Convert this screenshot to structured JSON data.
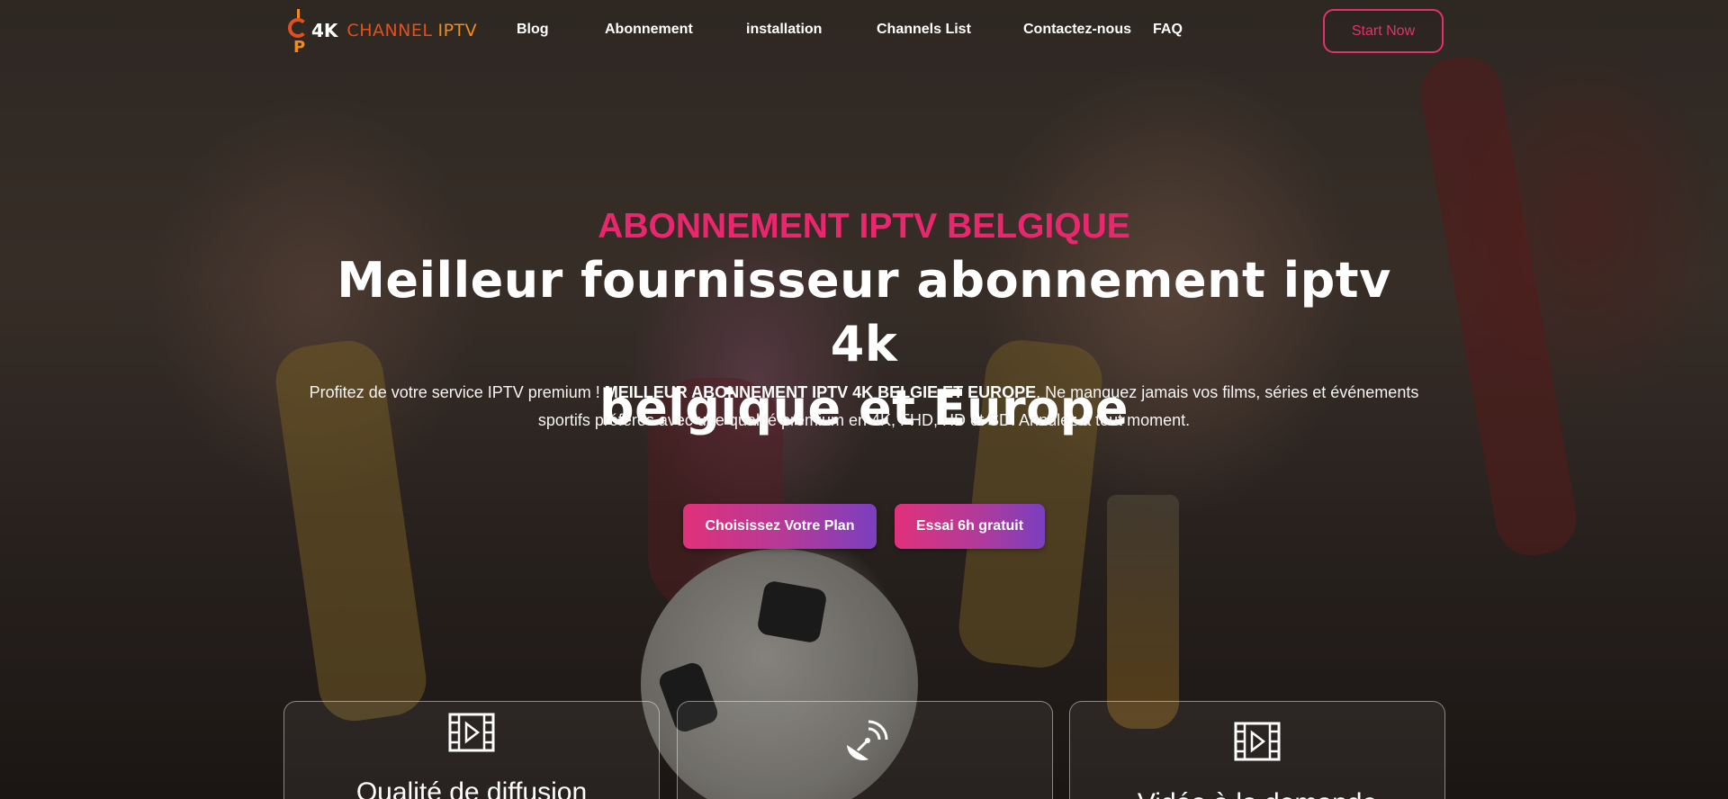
{
  "brand": {
    "logo_letter_p": "P",
    "prefix": "4K",
    "name_a": "CHANNEL",
    "name_b": "IPTV",
    "colors": {
      "orange_red": "#e2501d",
      "orange": "#f28c1a",
      "accent_pink": "#e9276f"
    }
  },
  "nav": {
    "items": [
      {
        "label": "Blog"
      },
      {
        "label": "Abonnement"
      },
      {
        "label": "installation"
      },
      {
        "label": "Channels List"
      },
      {
        "label": "Contactez-nous"
      },
      {
        "label": "FAQ"
      }
    ],
    "cta_label": "Start Now"
  },
  "hero": {
    "eyebrow": "ABONNEMENT IPTV BELGIQUE",
    "title_line1": "Meilleur fournisseur abonnement iptv 4k",
    "title_line2": "belgique et Europe",
    "desc_part1": "Profitez de votre service IPTV premium ! ",
    "desc_strong": "MEILLEUR ABONNEMENT IPTV 4K BELGIE ET EUROPE",
    "desc_part2": ". Ne manquez jamais vos films, séries et événements",
    "desc_line2": "sportifs préférés avec une qualité premium en 4K, FHD, HD et SD. Annulez à tout moment.",
    "primary_button": "Choisissez Votre Plan",
    "secondary_button": "Essai 6h gratuit"
  },
  "features": [
    {
      "icon": "film-play-icon",
      "title": "Qualité de diffusion"
    },
    {
      "icon": "satellite-dish-icon",
      "title": ""
    },
    {
      "icon": "film-play-icon",
      "title": "Vidéo à la demande"
    }
  ]
}
